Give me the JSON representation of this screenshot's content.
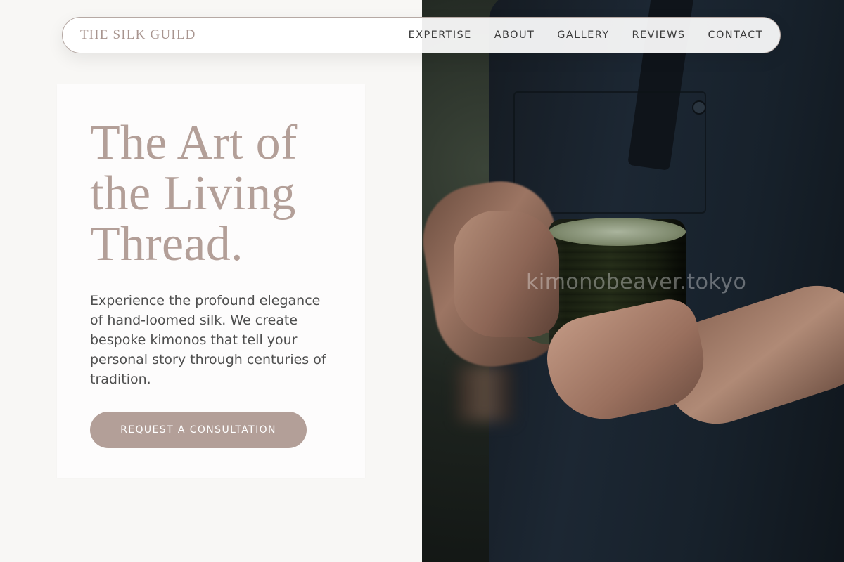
{
  "nav": {
    "brand": "THE SILK GUILD",
    "items": [
      "EXPERTISE",
      "ABOUT",
      "GALLERY",
      "REVIEWS",
      "CONTACT"
    ]
  },
  "hero": {
    "headline_lines": [
      "The Art of",
      "the Living",
      "Thread."
    ],
    "body": "Experience the profound elegance of hand-loomed silk. We create bespoke kimonos that tell your personal story through centuries of tradition.",
    "cta_label": "REQUEST A CONSULTATION"
  },
  "photo": {
    "watermark": "kimonobeaver.tokyo",
    "subject": "hands holding ceramic mug"
  },
  "colors": {
    "page_bg": "#f8f7f5",
    "accent": "#b39f98",
    "text": "#4e4e4e",
    "nav_text": "#3c3c3c"
  }
}
